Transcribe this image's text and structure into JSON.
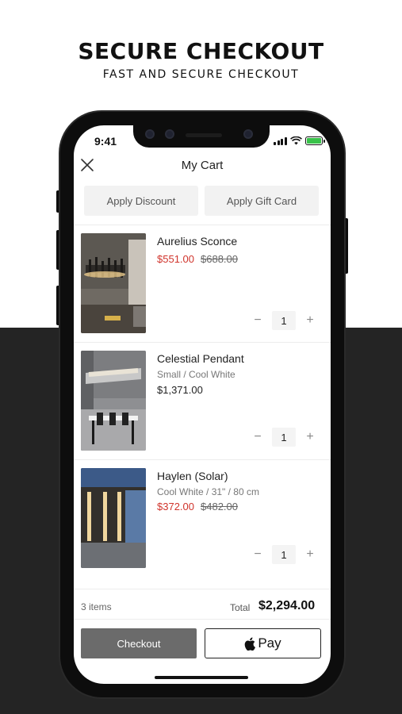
{
  "promo": {
    "headline": "SECURE CHECKOUT",
    "subheadline": "FAST AND SECURE CHECKOUT"
  },
  "status_bar": {
    "time": "9:41"
  },
  "nav": {
    "title": "My Cart"
  },
  "actions": {
    "discount": "Apply Discount",
    "gift_card": "Apply Gift Card"
  },
  "cart": {
    "items": [
      {
        "name": "Aurelius Sconce",
        "variant": "",
        "price": "$551.00",
        "compare_price": "$688.00",
        "quantity": "1",
        "on_sale": true
      },
      {
        "name": "Celestial Pendant",
        "variant": "Small / Cool White",
        "price": "$1,371.00",
        "compare_price": "",
        "quantity": "1",
        "on_sale": false
      },
      {
        "name": "Haylen (Solar)",
        "variant": "Cool White / 31\" / 80 cm",
        "price": "$372.00",
        "compare_price": "$482.00",
        "quantity": "1",
        "on_sale": true
      }
    ]
  },
  "summary": {
    "item_count": "3 items",
    "total_label": "Total",
    "total": "$2,294.00"
  },
  "buttons": {
    "checkout": "Checkout",
    "apple_pay": "Pay"
  },
  "colors": {
    "sale": "#d0342c",
    "checkout_bg": "#6b6b6b",
    "dark_bg": "#242424"
  }
}
